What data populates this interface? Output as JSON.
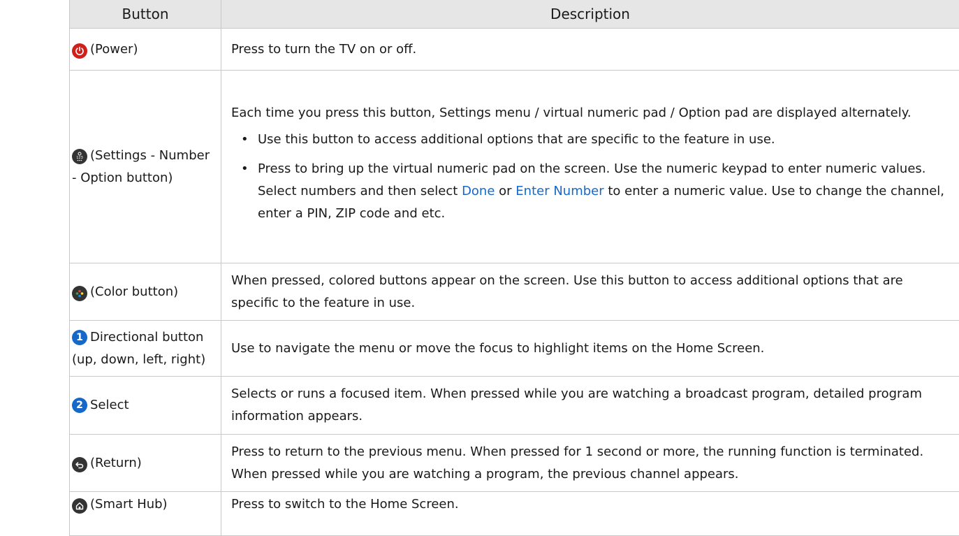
{
  "header": {
    "col_button": "Button",
    "col_description": "Description"
  },
  "rows": {
    "power": {
      "icon": "power-icon",
      "label": "(Power)",
      "desc": "Press to turn the TV on or off."
    },
    "settings": {
      "icon": "settings-number-option-icon",
      "label": "(Settings - Number - Option button)",
      "desc_intro": "Each time you press this button, Settings menu / virtual numeric pad / Option pad are displayed alternately.",
      "bullet1": "Use this button to access additional options that are specific to the feature in use.",
      "bullet2_a": "Press to bring up the virtual numeric pad on the screen. Use the numeric keypad to enter numeric values. Select numbers and then select ",
      "bullet2_done": "Done",
      "bullet2_or": " or ",
      "bullet2_enter": "Enter Number",
      "bullet2_b": " to enter a numeric value. Use to change the channel, enter a PIN, ZIP code and etc."
    },
    "color": {
      "icon": "color-button-icon",
      "label": "(Color button)",
      "desc": "When pressed, colored buttons appear on the screen. Use this button to access additional options that are specific to the feature in use."
    },
    "directional": {
      "num": "1",
      "label": "Directional button (up, down, left, right)",
      "desc": "Use to navigate the menu or move the focus to highlight items on the Home Screen."
    },
    "select": {
      "num": "2",
      "label": "Select",
      "desc": "Selects or runs a focused item. When pressed while you are watching a broadcast program, detailed program information appears."
    },
    "return": {
      "icon": "return-icon",
      "label": "(Return)",
      "desc": "Press to return to the previous menu. When pressed for 1 second or more, the running function is terminated. When pressed while you are watching a program, the previous channel appears."
    },
    "smarthub": {
      "icon": "home-icon",
      "label": "(Smart Hub)",
      "desc": "Press to switch to the Home Screen."
    }
  },
  "colors": {
    "accent": "#1769c9",
    "power_red": "#d0201a",
    "icon_dark": "#333333",
    "header_bg": "#e6e6e6"
  }
}
